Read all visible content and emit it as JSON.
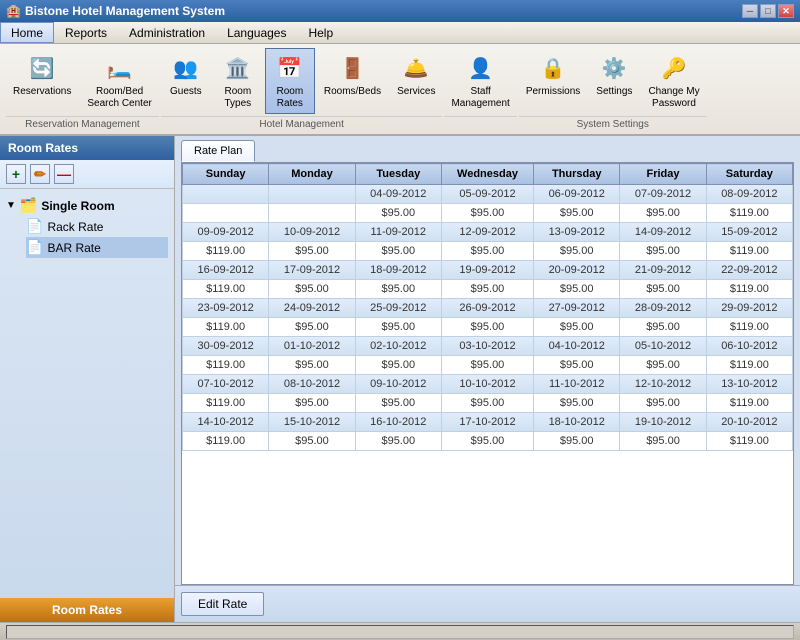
{
  "app": {
    "title": "Bistone Hotel Management System",
    "icon": "🏨"
  },
  "titlebar": {
    "minimize": "─",
    "maximize": "□",
    "close": "✕"
  },
  "menu": {
    "items": [
      "Home",
      "Reports",
      "Administration",
      "Languages",
      "Help"
    ]
  },
  "toolbar": {
    "groups": [
      {
        "label": "Reservation Management",
        "items": [
          {
            "icon": "🔄",
            "label": "Reservations"
          },
          {
            "icon": "🛏️",
            "label": "Room/Bed\nSearch Center"
          }
        ]
      },
      {
        "label": "Hotel Management",
        "items": [
          {
            "icon": "👥",
            "label": "Guests"
          },
          {
            "icon": "🏛️",
            "label": "Room\nTypes"
          },
          {
            "icon": "📅",
            "label": "Room\nRates",
            "active": true
          },
          {
            "icon": "🚪",
            "label": "Rooms/Beds"
          },
          {
            "icon": "🛎️",
            "label": "Services"
          }
        ]
      },
      {
        "label": "",
        "items": [
          {
            "icon": "👤",
            "label": "Staff\nManagement"
          }
        ]
      },
      {
        "label": "System Settings",
        "items": [
          {
            "icon": "🔒",
            "label": "Permissions"
          },
          {
            "icon": "⚙️",
            "label": "Settings"
          },
          {
            "icon": "🔑",
            "label": "Change My\nPassword"
          }
        ]
      }
    ]
  },
  "sidebar": {
    "title": "Room Rates",
    "bottom_label": "Room Rates",
    "add_btn": "+",
    "edit_btn": "✏",
    "delete_btn": "—",
    "tree": {
      "root": {
        "label": "Single Room",
        "icon": "🗂️",
        "children": [
          {
            "label": "Rack Rate",
            "icon": "📄"
          },
          {
            "label": "BAR Rate",
            "icon": "📄",
            "selected": true
          }
        ]
      }
    }
  },
  "tabs": [
    {
      "label": "Rate Plan",
      "active": true
    }
  ],
  "rate_table": {
    "headers": [
      "Sunday",
      "Monday",
      "Tuesday",
      "Wednesday",
      "Thursday",
      "Friday",
      "Saturday"
    ],
    "rows": [
      {
        "type": "date",
        "cells": [
          "",
          "",
          "04-09-2012",
          "05-09-2012",
          "06-09-2012",
          "07-09-2012",
          "08-09-2012"
        ]
      },
      {
        "type": "rate",
        "cells": [
          "",
          "",
          "$95.00",
          "$95.00",
          "$95.00",
          "$95.00",
          "$119.00"
        ]
      },
      {
        "type": "date",
        "cells": [
          "09-09-2012",
          "10-09-2012",
          "11-09-2012",
          "12-09-2012",
          "13-09-2012",
          "14-09-2012",
          "15-09-2012"
        ]
      },
      {
        "type": "rate",
        "cells": [
          "$119.00",
          "$95.00",
          "$95.00",
          "$95.00",
          "$95.00",
          "$95.00",
          "$119.00"
        ]
      },
      {
        "type": "date",
        "cells": [
          "16-09-2012",
          "17-09-2012",
          "18-09-2012",
          "19-09-2012",
          "20-09-2012",
          "21-09-2012",
          "22-09-2012"
        ]
      },
      {
        "type": "rate",
        "cells": [
          "$119.00",
          "$95.00",
          "$95.00",
          "$95.00",
          "$95.00",
          "$95.00",
          "$119.00"
        ]
      },
      {
        "type": "date",
        "cells": [
          "23-09-2012",
          "24-09-2012",
          "25-09-2012",
          "26-09-2012",
          "27-09-2012",
          "28-09-2012",
          "29-09-2012"
        ]
      },
      {
        "type": "rate",
        "cells": [
          "$119.00",
          "$95.00",
          "$95.00",
          "$95.00",
          "$95.00",
          "$95.00",
          "$119.00"
        ]
      },
      {
        "type": "date",
        "cells": [
          "30-09-2012",
          "01-10-2012",
          "02-10-2012",
          "03-10-2012",
          "04-10-2012",
          "05-10-2012",
          "06-10-2012"
        ]
      },
      {
        "type": "rate",
        "cells": [
          "$119.00",
          "$95.00",
          "$95.00",
          "$95.00",
          "$95.00",
          "$95.00",
          "$119.00"
        ]
      },
      {
        "type": "date",
        "cells": [
          "07-10-2012",
          "08-10-2012",
          "09-10-2012",
          "10-10-2012",
          "11-10-2012",
          "12-10-2012",
          "13-10-2012"
        ]
      },
      {
        "type": "rate",
        "cells": [
          "$119.00",
          "$95.00",
          "$95.00",
          "$95.00",
          "$95.00",
          "$95.00",
          "$119.00"
        ]
      },
      {
        "type": "date",
        "cells": [
          "14-10-2012",
          "15-10-2012",
          "16-10-2012",
          "17-10-2012",
          "18-10-2012",
          "19-10-2012",
          "20-10-2012"
        ]
      },
      {
        "type": "rate",
        "cells": [
          "$119.00",
          "$95.00",
          "$95.00",
          "$95.00",
          "$95.00",
          "$95.00",
          "$119.00"
        ]
      }
    ]
  },
  "buttons": {
    "edit_rate": "Edit Rate"
  }
}
